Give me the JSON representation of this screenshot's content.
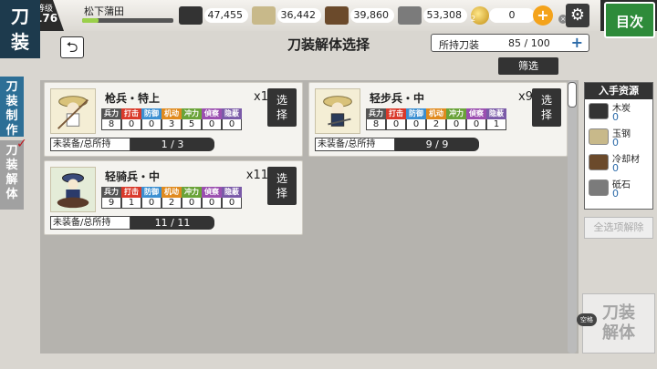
{
  "logo": {
    "line1": "刀",
    "line2": "装"
  },
  "player": {
    "level_label": "等级",
    "level": "176",
    "name": "松下蒲田",
    "exp_fraction": 0.18
  },
  "resources_top": [
    {
      "name": "charcoal",
      "value": "47,455",
      "color": "#333333"
    },
    {
      "name": "tamahagane",
      "value": "36,442",
      "color": "#c8b98a"
    },
    {
      "name": "cooling",
      "value": "39,860",
      "color": "#6b4a2b"
    },
    {
      "name": "whetstone",
      "value": "53,308",
      "color": "#7b7b7b"
    }
  ],
  "koban": {
    "value": "0",
    "badge": "2",
    "plus": "+"
  },
  "gear_icon": "⚙",
  "mini_close": "×",
  "green_button": "目次",
  "back_icon": "⮌",
  "title": "刀装解体选择",
  "owned": {
    "label": "所持刀装",
    "value": "85 / 100",
    "plus": "+"
  },
  "filter_label": "筛选",
  "tabs": {
    "craft": "刀装制作",
    "disassemble": "刀装解体",
    "check": "✓"
  },
  "stat_headers": [
    {
      "label": "兵力",
      "color": "#555555"
    },
    {
      "label": "打击",
      "color": "#d93a2b"
    },
    {
      "label": "防御",
      "color": "#3b8fd1"
    },
    {
      "label": "机动",
      "color": "#e08a1e"
    },
    {
      "label": "冲力",
      "color": "#6aa339"
    },
    {
      "label": "偵察",
      "color": "#9b4fb0"
    },
    {
      "label": "隐蔽",
      "color": "#7a5aa8"
    }
  ],
  "cards": [
    {
      "name": "枪兵・特上",
      "count": "x1",
      "select": "选择",
      "stats": [
        "8",
        "0",
        "0",
        "3",
        "5",
        "0",
        "0"
      ],
      "equip_label": "未装备/总所持",
      "equip_value": "1 / 3"
    },
    {
      "name": "轻步兵・中",
      "count": "x9",
      "select": "选择",
      "stats": [
        "8",
        "0",
        "0",
        "2",
        "0",
        "0",
        "1"
      ],
      "equip_label": "未装备/总所持",
      "equip_value": "9 / 9"
    },
    {
      "name": "轻骑兵・中",
      "count": "x11",
      "select": "选择",
      "stats": [
        "9",
        "1",
        "0",
        "2",
        "0",
        "0",
        "0"
      ],
      "equip_label": "未装备/总所持",
      "equip_value": "11 / 11"
    }
  ],
  "gain": {
    "title": "入手资源",
    "items": [
      {
        "name": "木炭",
        "value": "0",
        "color": "#333333"
      },
      {
        "name": "玉钢",
        "value": "0",
        "color": "#c8b98a"
      },
      {
        "name": "冷却材",
        "value": "0",
        "color": "#6b4a2b"
      },
      {
        "name": "砥石",
        "value": "0",
        "color": "#7b7b7b"
      }
    ]
  },
  "clear_all": "全选项解除",
  "disassemble_button": {
    "line1": "刀装",
    "line2": "解体"
  },
  "key_hint": "空格"
}
